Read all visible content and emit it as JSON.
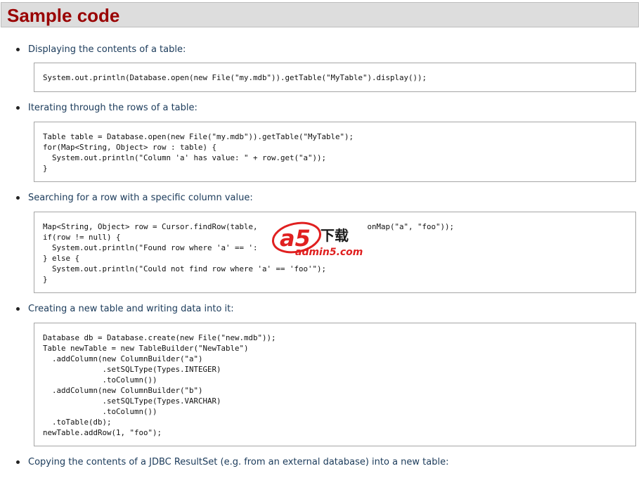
{
  "page": {
    "title": "Sample code"
  },
  "examples": [
    {
      "label": "Displaying the contents of a table:",
      "code": "System.out.println(Database.open(new File(\"my.mdb\")).getTable(\"MyTable\").display());"
    },
    {
      "label": "Iterating through the rows of a table:",
      "code": "Table table = Database.open(new File(\"my.mdb\")).getTable(\"MyTable\");\nfor(Map<String, Object> row : table) {\n  System.out.println(\"Column 'a' has value: \" + row.get(\"a\"));\n}"
    },
    {
      "label": "Searching for a row with a specific column value:",
      "code": "Map<String, Object> row = Cursor.findRow(table,                        onMap(\"a\", \"foo\"));\nif(row != null) {\n  System.out.println(\"Found row where 'a' == ':\n} else {\n  System.out.println(\"Could not find row where 'a' == 'foo'\");\n}"
    },
    {
      "label": "Creating a new table and writing data into it:",
      "code": "Database db = Database.create(new File(\"new.mdb\"));\nTable newTable = new TableBuilder(\"NewTable\")\n  .addColumn(new ColumnBuilder(\"a\")\n             .setSQLType(Types.INTEGER)\n             .toColumn())\n  .addColumn(new ColumnBuilder(\"b\")\n             .setSQLType(Types.VARCHAR)\n             .toColumn())\n  .toTable(db);\nnewTable.addRow(1, \"foo\");"
    },
    {
      "label": "Copying the contents of a JDBC ResultSet (e.g. from an external database) into a new table:"
    }
  ],
  "watermark": {
    "logo_mark": "a5",
    "logo_chars": "下载",
    "site": "admin5.com",
    "colors": {
      "red": "#e02020",
      "blue": "#1a3fb0"
    }
  }
}
